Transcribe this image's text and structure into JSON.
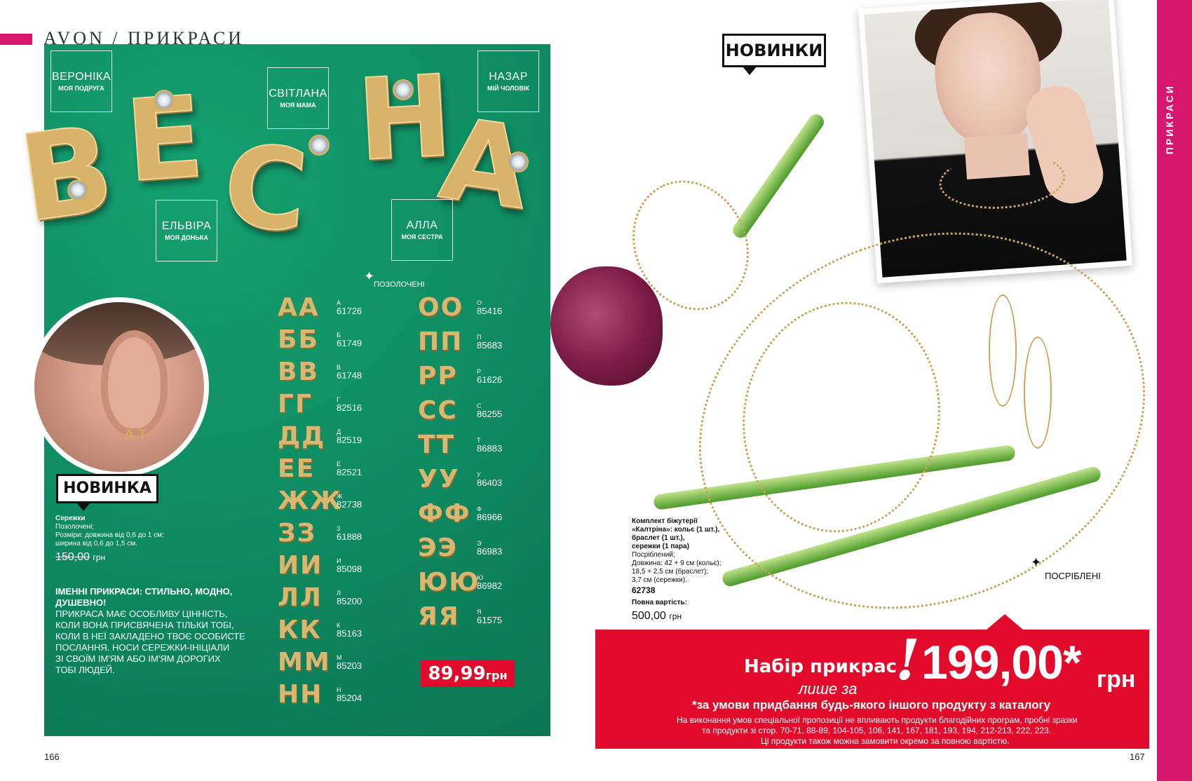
{
  "header": {
    "brand": "AVON / ПРИКРАСИ"
  },
  "left": {
    "big_word": [
      "В",
      "Е",
      "С",
      "Н",
      "А"
    ],
    "names": [
      {
        "name": "ВЕРОНІКА",
        "role": "МОЯ ПОДРУГА"
      },
      {
        "name": "СВІТЛАНА",
        "role": "МОЯ МАМА"
      },
      {
        "name": "НАЗАР",
        "role": "МІЙ ЧОЛОВІК"
      },
      {
        "name": "ЕЛЬВІРА",
        "role": "МОЯ ДОНЬКА"
      },
      {
        "name": "АЛЛА",
        "role": "МОЯ СЕСТРА"
      }
    ],
    "gilded_label": "ПОЗОЛОЧЕНІ",
    "novinka": "НОВИНКА",
    "ear_stud": "А Т",
    "product": {
      "title": "Сережки",
      "line1": "Позолочені;",
      "line2": "Розміри: довжина від 0,6 до 1 см;",
      "line3": "ширина від 0,6 до 1,5 см.",
      "old_price": "150,00",
      "currency": "грн"
    },
    "letters_left": [
      {
        "pair": "АА",
        "letter": "А",
        "code": "61726"
      },
      {
        "pair": "ББ",
        "letter": "Б",
        "code": "61749"
      },
      {
        "pair": "ВВ",
        "letter": "В",
        "code": "61748"
      },
      {
        "pair": "ГГ",
        "letter": "Г",
        "code": "82516"
      },
      {
        "pair": "ДД",
        "letter": "Д",
        "code": "82519"
      },
      {
        "pair": "ЕЕ",
        "letter": "Е",
        "code": "82521"
      },
      {
        "pair": "ЖЖ",
        "letter": "Ж",
        "code": "82738"
      },
      {
        "pair": "ЗЗ",
        "letter": "З",
        "code": "61888"
      },
      {
        "pair": "ИИ",
        "letter": "И",
        "code": "85098"
      },
      {
        "pair": "ЛЛ",
        "letter": "Л",
        "code": "85200"
      },
      {
        "pair": "КК",
        "letter": "К",
        "code": "85163"
      },
      {
        "pair": "ММ",
        "letter": "М",
        "code": "85203"
      },
      {
        "pair": "НН",
        "letter": "Н",
        "code": "85204"
      }
    ],
    "letters_right": [
      {
        "pair": "ОО",
        "letter": "О",
        "code": "85416"
      },
      {
        "pair": "ПП",
        "letter": "П",
        "code": "85683"
      },
      {
        "pair": "РР",
        "letter": "Р",
        "code": "61626"
      },
      {
        "pair": "СС",
        "letter": "С",
        "code": "86255"
      },
      {
        "pair": "ТТ",
        "letter": "Т",
        "code": "86883"
      },
      {
        "pair": "УУ",
        "letter": "У",
        "code": "86403"
      },
      {
        "pair": "ФФ",
        "letter": "Ф",
        "code": "86966"
      },
      {
        "pair": "ЭЭ",
        "letter": "Э",
        "code": "86983"
      },
      {
        "pair": "ЮЮ",
        "letter": "Ю",
        "code": "86982"
      },
      {
        "pair": "ЯЯ",
        "letter": "Я",
        "code": "61575"
      }
    ],
    "price": "89,99",
    "price_currency": "грн",
    "headline1": "ІМЕННІ ПРИКРАСИ: СТИЛЬНО, МОДНО,",
    "headline2": "ДУШЕВНО!",
    "body": [
      "ПРИКРАСА МАЄ ОСОБЛИВУ ЦІННІСТЬ,",
      "КОЛИ ВОНА ПРИСВЯЧЕНА ТІЛЬКИ ТОБІ,",
      "КОЛИ В НЕЇ ЗАКЛАДЕНО ТВОЄ ОСОБИСТЕ",
      "ПОСЛАННЯ. НОСИ СЕРЕЖКИ-ІНІЦІАЛИ",
      "ЗІ СВОЇМ ІМ'ЯМ АБО ІМ'ЯМ ДОРОГИХ",
      "ТОБІ ЛЮДЕЙ."
    ],
    "page_number": "166"
  },
  "right": {
    "novinky": "НОВИНКИ",
    "side_label": "ПРИКРАСИ",
    "silver_label": "ПОСРІБЛЕНІ",
    "product": {
      "l1": "Комплект біжутерії",
      "l2": "«Калтріна»: кольє (1 шт.),",
      "l3": "браслет (1 шт.),",
      "l4": "сережки (1 пара)",
      "l5": "Посріблений;",
      "l6": "Довжина: 42 + 9 см (кольє);",
      "l7": "18,5 + 2,5 см (браслет);",
      "l8": "3,7 см (сережки).",
      "code": "62738",
      "full_label": "Повна вартість:",
      "full_price": "500,00",
      "currency": "грн"
    },
    "banner": {
      "set": "Набір прикрас",
      "only": "лише за",
      "price": "199,00*",
      "currency": "грн",
      "condition": "*за умови придбання будь-якого іншого продукту з каталогу",
      "fine1": "На виконання умов спеціальної пропозиції не впливають продукти благодійних програм, пробні зразки",
      "fine2": "та продукти зі стор. 70-71, 88-89, 104-105, 106, 141, 167, 181, 193, 194, 212-213, 222, 223.",
      "fine3": "Ці продукти також можна замовити окремо за повною вартістю."
    },
    "page_number": "167"
  },
  "colors": {
    "accent": "#d9166f",
    "green": "#0e8a61",
    "red": "#e30b2c",
    "gold": "#d8b770"
  }
}
